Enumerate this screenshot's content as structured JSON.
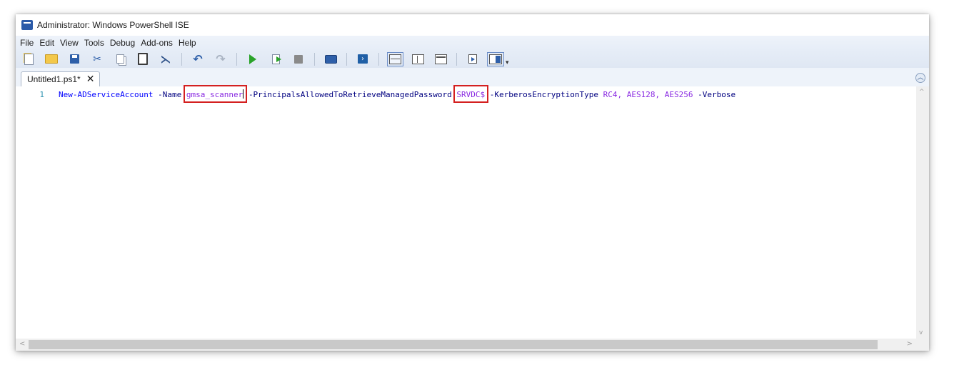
{
  "window": {
    "title": "Administrator: Windows PowerShell ISE"
  },
  "menu": [
    "File",
    "Edit",
    "View",
    "Tools",
    "Debug",
    "Add-ons",
    "Help"
  ],
  "toolbar": {
    "icons": [
      "new-icon",
      "open-icon",
      "save-icon",
      "cut-icon",
      "copy-icon",
      "paste-icon",
      "clear-console-icon",
      "undo-icon",
      "redo-icon",
      "run-script-icon",
      "run-selection-icon",
      "stop-icon",
      "remote-powershell-icon",
      "powershell-console-icon",
      "layout-script-top-icon",
      "layout-script-right-icon",
      "layout-script-maximized-icon",
      "show-script-pane-icon",
      "show-command-addon-icon",
      "toolbar-overflow-icon"
    ]
  },
  "tabs": [
    {
      "label": "Untitled1.ps1*",
      "close_glyph": "✕"
    }
  ],
  "editor": {
    "lines": [
      {
        "number": "1",
        "tokens": {
          "cmdlet": "New-ADServiceAccount",
          "param_name": "-Name",
          "name_value": "gmsa_scanner",
          "param_principals": "-PrincipalsAllowedToRetrieveManagedPassword",
          "principals_value": "SRVDC$",
          "param_kerberos": "-KerberosEncryptionType",
          "enc_rc4": "RC4,",
          "enc_aes128": "AES128,",
          "enc_aes256": "AES256",
          "param_verbose": "-Verbose"
        }
      }
    ]
  },
  "scrollbars": {
    "up_arrow": "^",
    "down_arrow": "v",
    "left_arrow": "<",
    "right_arrow": ">"
  },
  "colors": {
    "cmdlet": "#0000ff",
    "parameter": "#000080",
    "string": "#8a2be2",
    "highlight_box": "#d42020"
  }
}
